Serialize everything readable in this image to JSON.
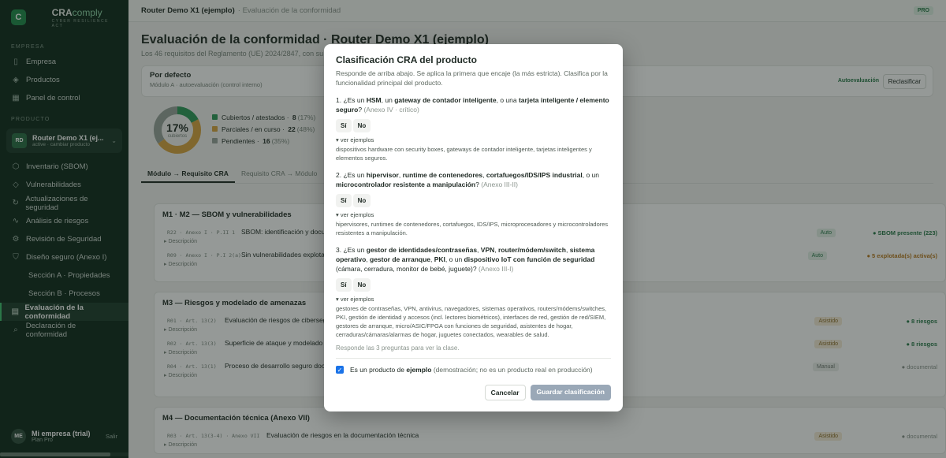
{
  "brand": {
    "logo_letter": "C",
    "name_a": "CRA",
    "name_b": "comply",
    "subtitle": "CYBER RESILIENCE ACT"
  },
  "sidebar": {
    "section_company": "EMPRESA",
    "company_items": [
      {
        "label": "Empresa",
        "icon": "building-icon"
      },
      {
        "label": "Productos",
        "icon": "layers-icon"
      },
      {
        "label": "Panel de control",
        "icon": "grid-icon"
      }
    ],
    "section_product": "PRODUCTO",
    "product_card": {
      "initials": "RD",
      "name": "Router Demo X1 (ej...",
      "sub": "active · cambiar producto"
    },
    "product_items": [
      {
        "label": "Inventario (SBOM)",
        "icon": "box-icon"
      },
      {
        "label": "Vulnerabilidades",
        "icon": "shield-icon"
      },
      {
        "label": "Actualizaciones de seguridad",
        "icon": "refresh-icon"
      },
      {
        "label": "Análisis de riesgos",
        "icon": "pulse-icon"
      },
      {
        "label": "Revisión de Seguridad",
        "icon": "gear-icon"
      },
      {
        "label": "Diseño seguro (Anexo I)",
        "icon": "shield-check-icon"
      },
      {
        "label": "Sección A · Propiedades",
        "icon": ""
      },
      {
        "label": "Sección B · Procesos",
        "icon": ""
      },
      {
        "label": "Evaluación de la conformidad",
        "icon": "clipboard-icon"
      },
      {
        "label": "Declaración de conformidad",
        "icon": "search-icon"
      }
    ],
    "user": {
      "initials": "ME",
      "name": "Mi empresa (trial)",
      "plan": "Plan Pro",
      "logout": "Salir"
    }
  },
  "topbar": {
    "crumb_product": "Router Demo X1 (ejemplo)",
    "crumb_page": "· Evaluación de la conformidad",
    "badge": "PRO"
  },
  "page": {
    "title": "Evaluación de la conformidad · Router Demo X1 (ejemplo)",
    "subtitle": "Los 46 requisitos del Reglamento (UE) 2024/2847, con su re"
  },
  "profile": {
    "title": "Por defecto",
    "sub": "Módulo A · autoevaluación (control interno)",
    "mode": "Autoevaluación",
    "reclassify": "Reclasificar"
  },
  "chart_data": {
    "type": "pie",
    "center_label": "17%",
    "center_sub": "cubiertos",
    "categories": [
      "Cubiertos / atestados",
      "Parciales / en curso",
      "Pendientes"
    ],
    "values": [
      8,
      22,
      16
    ],
    "percents": [
      "(17%)",
      "(48%)",
      "(35%)"
    ],
    "colors": [
      "#2e9a5a",
      "#d9a441",
      "#98a29b"
    ]
  },
  "tabs": [
    "Módulo → Requisito CRA",
    "Requisito CRA → Módulo"
  ],
  "groups": [
    {
      "title": "M1 · M2 — SBOM y vulnerabilidades",
      "rows": [
        {
          "ref": "R22 · Anexo I · P.II 1",
          "name": "SBOM: identificación y documen",
          "desc": "▸ Descripción",
          "badge": "Auto",
          "status": "● SBOM presente (223)"
        },
        {
          "ref": "R09 · Anexo I · P.I 2(a)",
          "name": "Sin vulnerabilidades explotable",
          "desc": "▸ Descripción",
          "badge": "Auto",
          "status": "● 5 explotada(s) activa(s)"
        }
      ]
    },
    {
      "title": "M3 — Riesgos y modelado de amenazas",
      "rows": [
        {
          "ref": "R01 · Art. 13(2)",
          "name": "Evaluación de riesgos de ciberseguri",
          "desc": "▸ Descripción",
          "badge": "Asistido",
          "status": "● 8 riesgos"
        },
        {
          "ref": "R02 · Art. 13(3)",
          "name": "Superficie de ataque y modelado de ar",
          "desc": "▸ Descripción",
          "badge": "Asistido",
          "status": "● 8 riesgos"
        },
        {
          "ref": "R04 · Art. 13(1)",
          "name": "Proceso de desarrollo seguro documen",
          "desc": "▸ Descripción",
          "badge": "Manual",
          "status": "● documental"
        }
      ]
    },
    {
      "title": "M4 — Documentación técnica (Anexo VII)",
      "rows": [
        {
          "ref": "R03 · Art. 13(3-4) · Anexo VII",
          "name": "Evaluación de riesgos en la documentación técnica",
          "desc": "▸ Descripción",
          "badge": "Asistido",
          "status": "● documental"
        }
      ]
    }
  ],
  "modal": {
    "title": "Clasificación CRA del producto",
    "sub": "Responde de arriba abajo. Se aplica la primera que encaje (la más estricta). Clasifica por la funcionalidad principal del producto.",
    "yes": "Sí",
    "no": "No",
    "examples_toggle": "▾ ver ejemplos",
    "questions": [
      {
        "html_parts": [
          "1. ¿Es un ",
          "HSM",
          ", un ",
          "gateway de contador inteligente",
          ", o una ",
          "tarjeta inteligente / elemento seguro",
          "? "
        ],
        "annex": "(Anexo IV · crítico)",
        "examples": "dispositivos hardware con security boxes, gateways de contador inteligente, tarjetas inteligentes y elementos seguros."
      },
      {
        "html_parts": [
          "2. ¿Es un ",
          "hipervisor",
          ", ",
          "runtime de contenedores",
          ", ",
          "cortafuegos/IDS/IPS industrial",
          ", o un ",
          "microcontrolador resistente a manipulación",
          "? "
        ],
        "annex": "(Anexo III-II)",
        "examples": "hipervisores, runtimes de contenedores, cortafuegos, IDS/IPS, microprocesadores y microcontroladores resistentes a manipulación."
      },
      {
        "html_parts": [
          "3. ¿Es un ",
          "gestor de identidades/contraseñas",
          ", ",
          "VPN",
          ", ",
          "router/módem/switch",
          ", ",
          "sistema operativo",
          ", ",
          "gestor de arranque",
          ", ",
          "PKI",
          ", o un ",
          "dispositivo IoT con función de seguridad",
          " (cámara, cerradura, monitor de bebé, juguete)? "
        ],
        "annex": "(Anexo III-I)",
        "examples": "gestores de contraseñas, VPN, antivirus, navegadores, sistemas operativos, routers/módems/switches, PKI, gestión de identidad y accesos (incl. lectores biométricos), interfaces de red, gestión de red/SIEM, gestores de arranque, micro/ASIC/FPGA con funciones de seguridad, asistentes de hogar, cerraduras/cámaras/alarmas de hogar, juguetes conectados, wearables de salud."
      }
    ],
    "hint": "Responde las 3 preguntas para ver la clase.",
    "checkbox_a": "Es un producto de ",
    "checkbox_b": "ejemplo",
    "checkbox_c": " (demostración; no es un producto real en producción)",
    "cancel": "Cancelar",
    "save": "Guardar clasificación"
  }
}
